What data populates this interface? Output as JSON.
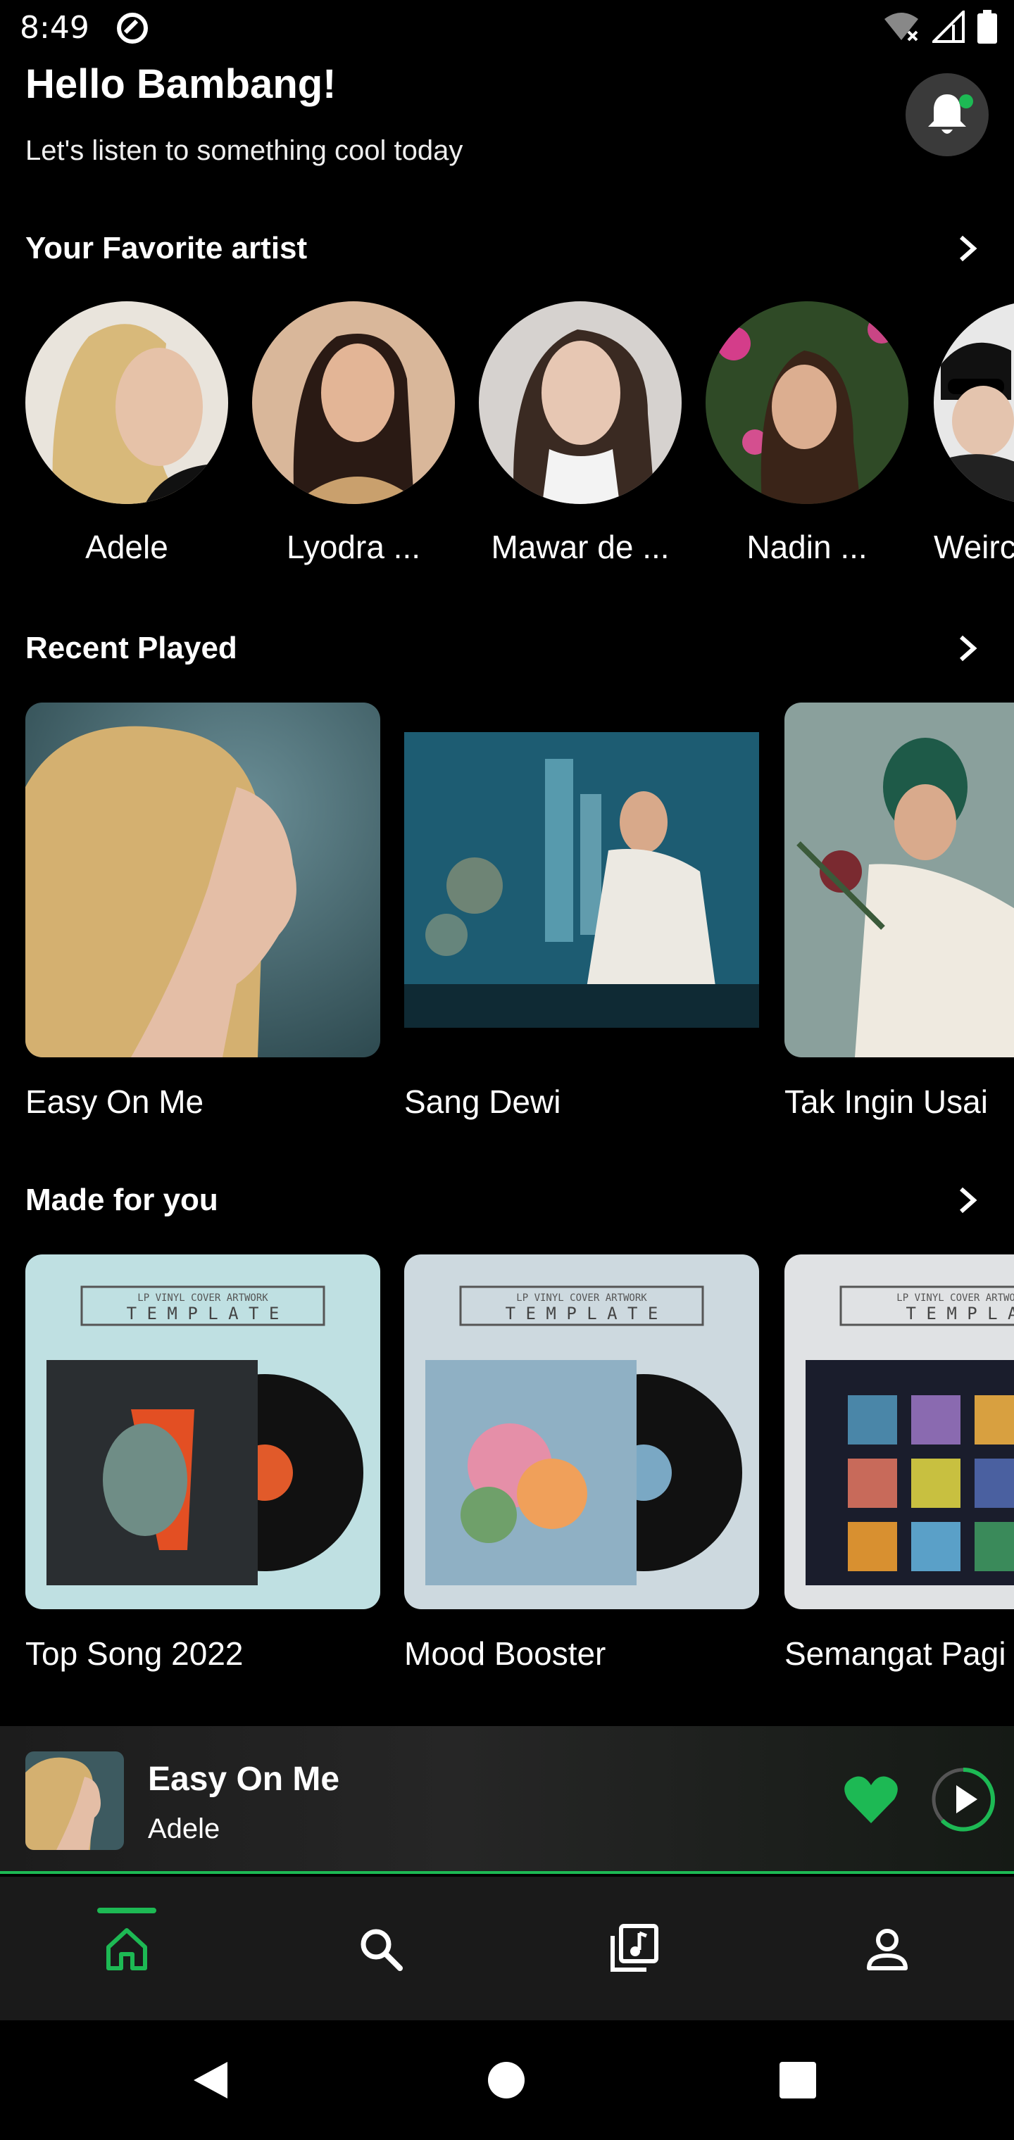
{
  "status_bar": {
    "time": "8:49"
  },
  "header": {
    "greeting": "Hello Bambang!",
    "subtitle": "Let's listen to something cool today"
  },
  "sections": {
    "favorite_artist": "Your Favorite artist",
    "recent_played": "Recent Played",
    "made_for_you": "Made for you"
  },
  "artists": [
    {
      "name": "Adele"
    },
    {
      "name": "Lyodra ..."
    },
    {
      "name": "Mawar de ..."
    },
    {
      "name": "Nadin ..."
    },
    {
      "name": "Weirc"
    }
  ],
  "recent_played": [
    {
      "title": "Easy On Me"
    },
    {
      "title": "Sang Dewi"
    },
    {
      "title": "Tak Ingin Usai"
    }
  ],
  "made_for_you": [
    {
      "title": "Top Song 2022",
      "cover_header": "LP VINYL COVER ARTWORK",
      "cover_word": "T E M P L A T E"
    },
    {
      "title": "Mood Booster",
      "cover_header": "LP VINYL COVER ARTWORK",
      "cover_word": "T E M P L A T E"
    },
    {
      "title": "Semangat Pagi",
      "cover_header": "LP VINYL COVER ARTWORK",
      "cover_word": "T E M P L A"
    }
  ],
  "now_playing": {
    "title": "Easy On Me",
    "artist": "Adele"
  },
  "colors": {
    "accent": "#1db954",
    "background": "#000000",
    "bell_bg": "#3a3a3a"
  },
  "icons": {
    "nav": [
      "home-icon",
      "search-icon",
      "library-icon",
      "profile-icon"
    ],
    "system": [
      "back-icon",
      "home-circle-icon",
      "recents-icon"
    ]
  }
}
